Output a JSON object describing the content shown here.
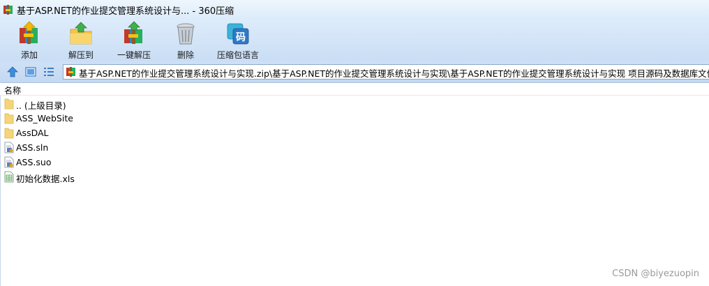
{
  "window": {
    "title": "基于ASP.NET的作业提交管理系统设计与... - 360压缩",
    "app_icon": "archive-icon"
  },
  "toolbar": {
    "buttons": [
      {
        "label": "添加",
        "icon": "add-archive-icon"
      },
      {
        "label": "解压到",
        "icon": "extract-to-icon"
      },
      {
        "label": "一键解压",
        "icon": "one-click-extract-icon"
      },
      {
        "label": "删除",
        "icon": "trash-icon"
      },
      {
        "label": "压缩包语言",
        "icon": "encoding-icon",
        "icon_text": "码"
      }
    ]
  },
  "address": {
    "path": "基于ASP.NET的作业提交管理系统设计与实现.zip\\基于ASP.NET的作业提交管理系统设计与实现\\基于ASP.NET的作业提交管理系统设计与实现 项目源码及数据库文件 - 解"
  },
  "list": {
    "column_name": "名称",
    "items": [
      {
        "name": ".. (上级目录)",
        "type": "folder"
      },
      {
        "name": "ASS_WebSite",
        "type": "folder"
      },
      {
        "name": "AssDAL",
        "type": "folder"
      },
      {
        "name": "ASS.sln",
        "type": "file"
      },
      {
        "name": "ASS.suo",
        "type": "file"
      },
      {
        "name": "初始化数据.xls",
        "type": "spreadsheet"
      }
    ]
  },
  "watermark": "CSDN @biyezuopin",
  "colors": {
    "toolbar_top": "#ddecfb",
    "toolbar_bottom": "#c9ddf4",
    "folder": "#f6d57a",
    "accent": "#2f79c7"
  }
}
